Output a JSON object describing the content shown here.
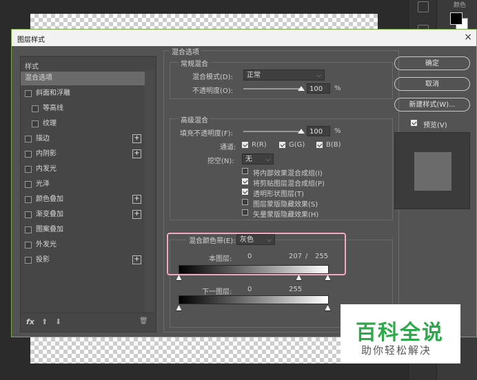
{
  "window": {
    "title": "图层样式",
    "close": "×"
  },
  "style_list": {
    "header": "样式",
    "items": [
      {
        "label": "混合选项",
        "checkbox": false,
        "plus": false,
        "selected": true,
        "indent": 0
      },
      {
        "label": "斜面和浮雕",
        "checkbox": true,
        "plus": false,
        "selected": false,
        "indent": 0
      },
      {
        "label": "等高线",
        "checkbox": true,
        "plus": false,
        "selected": false,
        "indent": 1
      },
      {
        "label": "纹理",
        "checkbox": true,
        "plus": false,
        "selected": false,
        "indent": 1
      },
      {
        "label": "描边",
        "checkbox": true,
        "plus": true,
        "selected": false,
        "indent": 0
      },
      {
        "label": "内阴影",
        "checkbox": true,
        "plus": true,
        "selected": false,
        "indent": 0
      },
      {
        "label": "内发光",
        "checkbox": true,
        "plus": false,
        "selected": false,
        "indent": 0
      },
      {
        "label": "光泽",
        "checkbox": true,
        "plus": false,
        "selected": false,
        "indent": 0
      },
      {
        "label": "颜色叠加",
        "checkbox": true,
        "plus": true,
        "selected": false,
        "indent": 0
      },
      {
        "label": "渐变叠加",
        "checkbox": true,
        "plus": true,
        "selected": false,
        "indent": 0
      },
      {
        "label": "图案叠加",
        "checkbox": true,
        "plus": false,
        "selected": false,
        "indent": 0
      },
      {
        "label": "外发光",
        "checkbox": true,
        "plus": false,
        "selected": false,
        "indent": 0
      },
      {
        "label": "投影",
        "checkbox": true,
        "plus": true,
        "selected": false,
        "indent": 0
      }
    ],
    "footer": {
      "fx": "fx",
      "up": "⬆",
      "down": "⬇",
      "trash": "🗑"
    }
  },
  "blend_options": {
    "title": "混合选项",
    "general": {
      "title": "常规混合",
      "blend_mode_label": "混合模式(D):",
      "blend_mode_value": "正常",
      "opacity_label": "不透明度(O):",
      "opacity_value": "100",
      "opacity_unit": "%",
      "opacity_fraction": 1.0
    },
    "advanced": {
      "title": "高级混合",
      "fill_label": "填充不透明度(F):",
      "fill_value": "100",
      "fill_unit": "%",
      "fill_fraction": 1.0,
      "channels_label": "通道:",
      "channel_r": "R(R)",
      "channel_g": "G(G)",
      "channel_b": "B(B)",
      "knockout_label": "挖空(N):",
      "knockout_value": "无",
      "options": [
        {
          "label": "将内部效果混合成组(I)",
          "checked": false
        },
        {
          "label": "将剪贴图层混合成组(P)",
          "checked": true
        },
        {
          "label": "透明形状图层(T)",
          "checked": true
        },
        {
          "label": "图层蒙版隐藏效果(S)",
          "checked": false
        },
        {
          "label": "矢量蒙版隐藏效果(H)",
          "checked": false
        }
      ]
    },
    "blend_if": {
      "label": "混合颜色带(E):",
      "value": "灰色",
      "this_layer_label": "本图层:",
      "this_layer_low": "0",
      "this_layer_split": "207",
      "this_layer_sep": "/",
      "this_layer_high": "255",
      "under_layer_label": "下一图层:",
      "under_layer_low": "0",
      "under_layer_high": "255"
    }
  },
  "buttons": {
    "ok": "确定",
    "cancel": "取消",
    "new_style": "新建样式(W)...",
    "preview_label": "预览(V)",
    "preview_checked": true
  },
  "watermark": {
    "title": "百科全说",
    "subtitle": "助你轻松解决"
  },
  "background_panel": {
    "tab": "颜色"
  }
}
